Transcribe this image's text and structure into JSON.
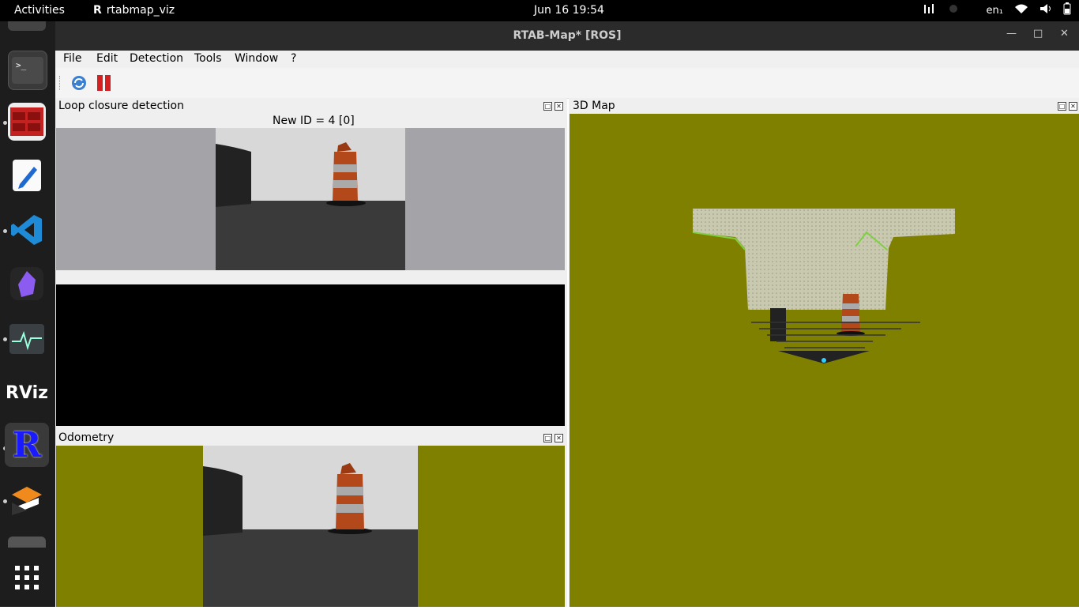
{
  "topbar": {
    "activities": "Activities",
    "app_name": "rtabmap_viz",
    "clock": "Jun 16  19:54",
    "keyboard": "en₁"
  },
  "window": {
    "title": "RTAB-Map* [ROS]"
  },
  "menu": [
    "File",
    "Edit",
    "Detection",
    "Tools",
    "Window",
    "?"
  ],
  "panels": {
    "loop_closure": {
      "title": "Loop closure detection",
      "new_id": "New ID = 4 [0]"
    },
    "map3d": {
      "title": "3D Map"
    },
    "odometry": {
      "title": "Odometry"
    }
  },
  "dock": [
    "terminal",
    "system-monitor-app",
    "text-editor",
    "vscode",
    "obsidian",
    "system-monitor",
    "rviz",
    "rtabmap",
    "app-store",
    "show-apps"
  ],
  "colors": {
    "olive_bg": "#808000",
    "gray_bg": "#a3a3a8",
    "black_view": "#000000"
  }
}
